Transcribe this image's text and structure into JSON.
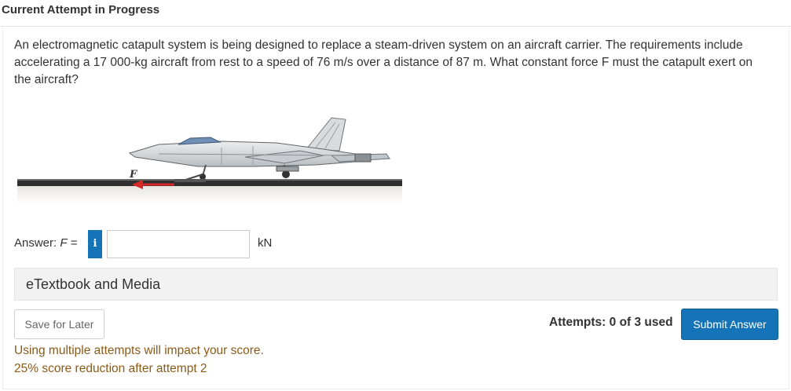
{
  "header": {
    "title": "Current Attempt in Progress"
  },
  "question": {
    "text": "An electromagnetic catapult system is being designed to replace a steam-driven system on an aircraft carrier. The requirements include accelerating a 17 000-kg aircraft from rest to a speed of 76 m/s over a distance of 87 m. What constant force F must the catapult exert on the aircraft?"
  },
  "figure": {
    "force_label": "F"
  },
  "answer": {
    "label_prefix": "Answer: ",
    "variable": "F",
    "label_suffix": " =",
    "info_icon": "i",
    "value": "",
    "unit": "kN"
  },
  "etextbook": {
    "label": "eTextbook and Media"
  },
  "actions": {
    "save_label": "Save for Later",
    "attempts_text": "Attempts: 0 of 3 used",
    "submit_label": "Submit Answer"
  },
  "notes": {
    "line1": "Using multiple attempts will impact your score.",
    "line2": "25% score reduction after attempt 2"
  }
}
